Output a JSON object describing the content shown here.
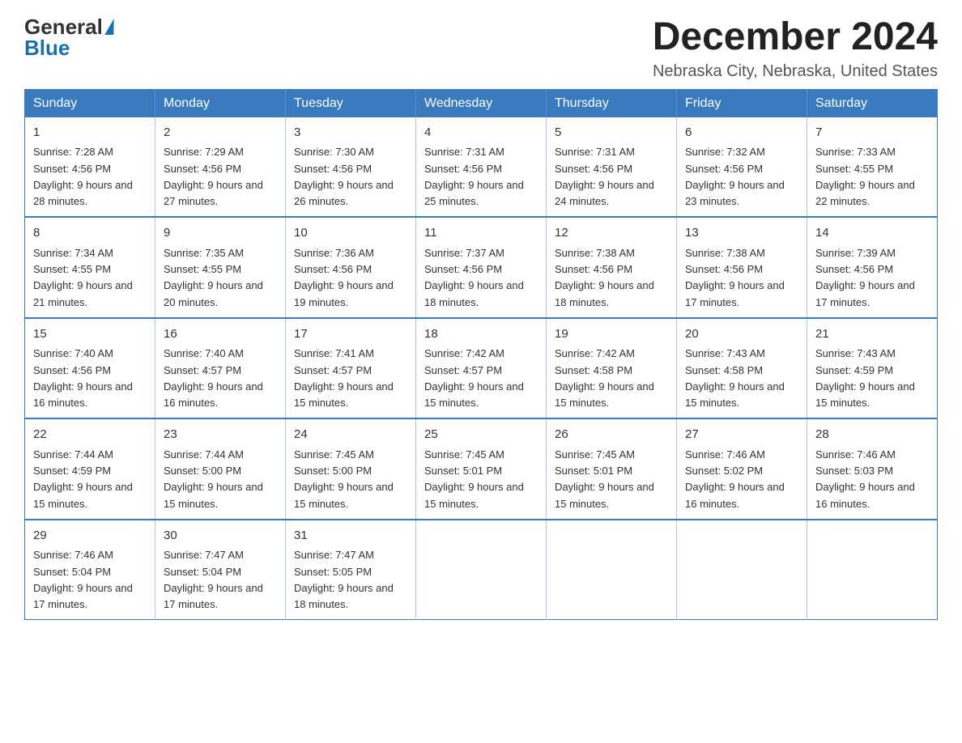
{
  "header": {
    "logo_general": "General",
    "logo_blue": "Blue",
    "month_title": "December 2024",
    "location": "Nebraska City, Nebraska, United States"
  },
  "weekdays": [
    "Sunday",
    "Monday",
    "Tuesday",
    "Wednesday",
    "Thursday",
    "Friday",
    "Saturday"
  ],
  "weeks": [
    [
      {
        "day": "1",
        "sunrise": "7:28 AM",
        "sunset": "4:56 PM",
        "daylight": "9 hours and 28 minutes."
      },
      {
        "day": "2",
        "sunrise": "7:29 AM",
        "sunset": "4:56 PM",
        "daylight": "9 hours and 27 minutes."
      },
      {
        "day": "3",
        "sunrise": "7:30 AM",
        "sunset": "4:56 PM",
        "daylight": "9 hours and 26 minutes."
      },
      {
        "day": "4",
        "sunrise": "7:31 AM",
        "sunset": "4:56 PM",
        "daylight": "9 hours and 25 minutes."
      },
      {
        "day": "5",
        "sunrise": "7:31 AM",
        "sunset": "4:56 PM",
        "daylight": "9 hours and 24 minutes."
      },
      {
        "day": "6",
        "sunrise": "7:32 AM",
        "sunset": "4:56 PM",
        "daylight": "9 hours and 23 minutes."
      },
      {
        "day": "7",
        "sunrise": "7:33 AM",
        "sunset": "4:55 PM",
        "daylight": "9 hours and 22 minutes."
      }
    ],
    [
      {
        "day": "8",
        "sunrise": "7:34 AM",
        "sunset": "4:55 PM",
        "daylight": "9 hours and 21 minutes."
      },
      {
        "day": "9",
        "sunrise": "7:35 AM",
        "sunset": "4:55 PM",
        "daylight": "9 hours and 20 minutes."
      },
      {
        "day": "10",
        "sunrise": "7:36 AM",
        "sunset": "4:56 PM",
        "daylight": "9 hours and 19 minutes."
      },
      {
        "day": "11",
        "sunrise": "7:37 AM",
        "sunset": "4:56 PM",
        "daylight": "9 hours and 18 minutes."
      },
      {
        "day": "12",
        "sunrise": "7:38 AM",
        "sunset": "4:56 PM",
        "daylight": "9 hours and 18 minutes."
      },
      {
        "day": "13",
        "sunrise": "7:38 AM",
        "sunset": "4:56 PM",
        "daylight": "9 hours and 17 minutes."
      },
      {
        "day": "14",
        "sunrise": "7:39 AM",
        "sunset": "4:56 PM",
        "daylight": "9 hours and 17 minutes."
      }
    ],
    [
      {
        "day": "15",
        "sunrise": "7:40 AM",
        "sunset": "4:56 PM",
        "daylight": "9 hours and 16 minutes."
      },
      {
        "day": "16",
        "sunrise": "7:40 AM",
        "sunset": "4:57 PM",
        "daylight": "9 hours and 16 minutes."
      },
      {
        "day": "17",
        "sunrise": "7:41 AM",
        "sunset": "4:57 PM",
        "daylight": "9 hours and 15 minutes."
      },
      {
        "day": "18",
        "sunrise": "7:42 AM",
        "sunset": "4:57 PM",
        "daylight": "9 hours and 15 minutes."
      },
      {
        "day": "19",
        "sunrise": "7:42 AM",
        "sunset": "4:58 PM",
        "daylight": "9 hours and 15 minutes."
      },
      {
        "day": "20",
        "sunrise": "7:43 AM",
        "sunset": "4:58 PM",
        "daylight": "9 hours and 15 minutes."
      },
      {
        "day": "21",
        "sunrise": "7:43 AM",
        "sunset": "4:59 PM",
        "daylight": "9 hours and 15 minutes."
      }
    ],
    [
      {
        "day": "22",
        "sunrise": "7:44 AM",
        "sunset": "4:59 PM",
        "daylight": "9 hours and 15 minutes."
      },
      {
        "day": "23",
        "sunrise": "7:44 AM",
        "sunset": "5:00 PM",
        "daylight": "9 hours and 15 minutes."
      },
      {
        "day": "24",
        "sunrise": "7:45 AM",
        "sunset": "5:00 PM",
        "daylight": "9 hours and 15 minutes."
      },
      {
        "day": "25",
        "sunrise": "7:45 AM",
        "sunset": "5:01 PM",
        "daylight": "9 hours and 15 minutes."
      },
      {
        "day": "26",
        "sunrise": "7:45 AM",
        "sunset": "5:01 PM",
        "daylight": "9 hours and 15 minutes."
      },
      {
        "day": "27",
        "sunrise": "7:46 AM",
        "sunset": "5:02 PM",
        "daylight": "9 hours and 16 minutes."
      },
      {
        "day": "28",
        "sunrise": "7:46 AM",
        "sunset": "5:03 PM",
        "daylight": "9 hours and 16 minutes."
      }
    ],
    [
      {
        "day": "29",
        "sunrise": "7:46 AM",
        "sunset": "5:04 PM",
        "daylight": "9 hours and 17 minutes."
      },
      {
        "day": "30",
        "sunrise": "7:47 AM",
        "sunset": "5:04 PM",
        "daylight": "9 hours and 17 minutes."
      },
      {
        "day": "31",
        "sunrise": "7:47 AM",
        "sunset": "5:05 PM",
        "daylight": "9 hours and 18 minutes."
      },
      null,
      null,
      null,
      null
    ]
  ],
  "labels": {
    "sunrise_prefix": "Sunrise: ",
    "sunset_prefix": "Sunset: ",
    "daylight_prefix": "Daylight: "
  }
}
